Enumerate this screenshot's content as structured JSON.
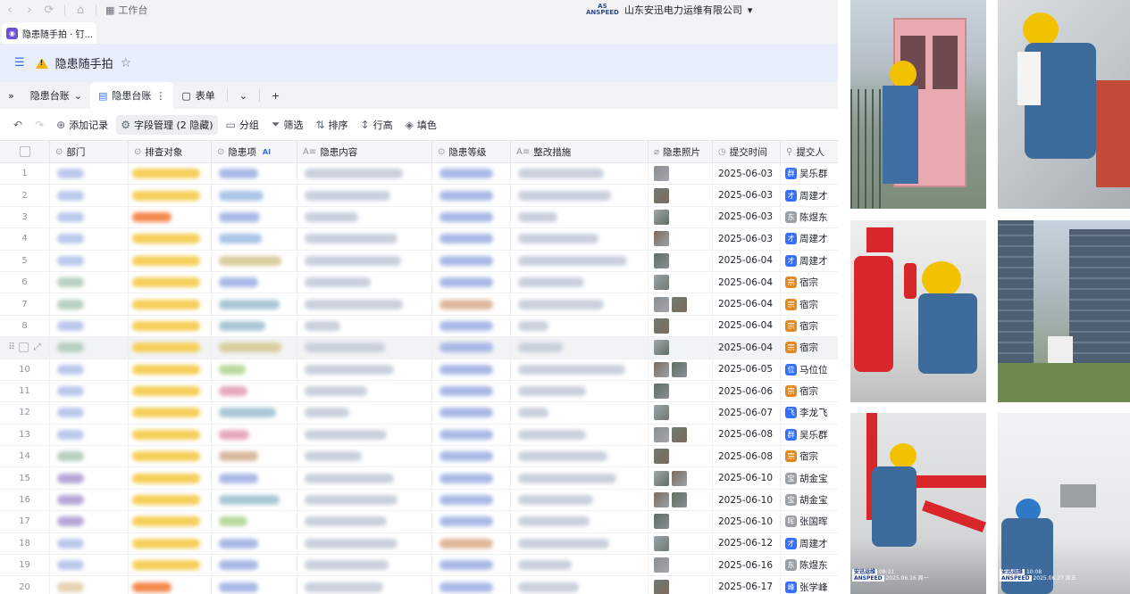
{
  "topbar": {
    "back": "‹",
    "forward": "›",
    "workspace_label": "工作台",
    "org_logo_top": "AS",
    "org_logo_bottom": "ANSPEED",
    "org_name": "山东安迅电力运维有限公司",
    "org_caret": "▾"
  },
  "browser_tab": {
    "icon": "◉",
    "title": "隐患随手拍 · 钉..."
  },
  "header": {
    "title": "隐患随手拍"
  },
  "view_tabs": {
    "collapse": "»",
    "ledger_dropdown": "隐患台账",
    "ledger_tab": "隐患台账",
    "form_tab": "表单",
    "more": "⌄",
    "add": "+"
  },
  "toolbar": {
    "undo": "↶",
    "redo": "↷",
    "add_record": "添加记录",
    "field_manage": "字段管理 (2 隐藏)",
    "group": "分组",
    "filter": "筛选",
    "sort": "排序",
    "row_height": "行高",
    "fill_color": "填色"
  },
  "columns": {
    "dept": "部门",
    "target": "排查对象",
    "item": "隐患项",
    "item_ai": "AI",
    "content": "隐患内容",
    "level": "隐患等级",
    "measure": "整改措施",
    "photos": "隐患照片",
    "time": "提交时间",
    "submitter": "提交人"
  },
  "colors": {
    "accent": "#3370ff",
    "header_bg": "#e8eefc",
    "warning": "#f5b400"
  },
  "rows": [
    {
      "num": "1",
      "date": "2025-06-03",
      "user": "吴乐群",
      "av": "blue",
      "target": "yellow",
      "photos": 1,
      "level": "blue"
    },
    {
      "num": "2",
      "date": "2025-06-03",
      "user": "周建才",
      "av": "blue",
      "target": "yellow",
      "photos": 1,
      "level": "blue"
    },
    {
      "num": "3",
      "date": "2025-06-03",
      "user": "陈煜东",
      "av": "photo",
      "target": "orange",
      "photos": 1,
      "level": "blue"
    },
    {
      "num": "4",
      "date": "2025-06-03",
      "user": "周建才",
      "av": "blue",
      "target": "yellow",
      "photos": 1,
      "level": "blue"
    },
    {
      "num": "5",
      "date": "2025-06-04",
      "user": "周建才",
      "av": "blue",
      "target": "yellow",
      "photos": 1,
      "level": "blue"
    },
    {
      "num": "6",
      "date": "2025-06-04",
      "user": "宿宗",
      "av": "orange",
      "target": "yellow",
      "photos": 1,
      "level": "blue"
    },
    {
      "num": "7",
      "date": "2025-06-04",
      "user": "宿宗",
      "av": "orange",
      "target": "yellow",
      "photos": 2,
      "level": "orange"
    },
    {
      "num": "8",
      "date": "2025-06-04",
      "user": "宿宗",
      "av": "orange",
      "target": "yellow",
      "photos": 1,
      "level": "blue"
    },
    {
      "num": "",
      "date": "2025-06-04",
      "user": "宿宗",
      "av": "orange",
      "target": "yellow",
      "photos": 1,
      "level": "blue"
    },
    {
      "num": "10",
      "date": "2025-06-05",
      "user": "马位位",
      "av": "blue",
      "target": "yellow",
      "photos": 2,
      "level": "blue"
    },
    {
      "num": "11",
      "date": "2025-06-06",
      "user": "宿宗",
      "av": "orange",
      "target": "yellow",
      "photos": 1,
      "level": "blue"
    },
    {
      "num": "12",
      "date": "2025-06-07",
      "user": "李龙飞",
      "av": "blue",
      "target": "yellow",
      "photos": 1,
      "level": "blue"
    },
    {
      "num": "13",
      "date": "2025-06-08",
      "user": "吴乐群",
      "av": "blue",
      "target": "yellow",
      "photos": 2,
      "level": "blue"
    },
    {
      "num": "14",
      "date": "2025-06-08",
      "user": "宿宗",
      "av": "orange",
      "target": "yellow",
      "photos": 1,
      "level": "blue"
    },
    {
      "num": "15",
      "date": "2025-06-10",
      "user": "胡金宝",
      "av": "photo",
      "target": "yellow",
      "photos": 2,
      "level": "blue"
    },
    {
      "num": "16",
      "date": "2025-06-10",
      "user": "胡金宝",
      "av": "photo",
      "target": "yellow",
      "photos": 2,
      "level": "blue"
    },
    {
      "num": "17",
      "date": "2025-06-10",
      "user": "张国晖",
      "av": "photo",
      "target": "yellow",
      "photos": 1,
      "level": "blue"
    },
    {
      "num": "18",
      "date": "2025-06-12",
      "user": "周建才",
      "av": "blue",
      "target": "yellow",
      "photos": 1,
      "level": "orange"
    },
    {
      "num": "19",
      "date": "2025-06-16",
      "user": "陈煜东",
      "av": "photo",
      "target": "yellow",
      "photos": 1,
      "level": "blue"
    },
    {
      "num": "20",
      "date": "2025-06-17",
      "user": "张学峰",
      "av": "blue",
      "target": "orange",
      "photos": 1,
      "level": "blue"
    }
  ],
  "photo_watermarks": [
    {
      "brand_cn": "安迅运维",
      "brand_en": "ANSPEED",
      "time": "08:21",
      "date": "2025.06.16 周一"
    },
    {
      "brand_cn": "安迅运维",
      "brand_en": "ANSPEED",
      "time": "10:08",
      "date": "2025.06.27 周五"
    }
  ]
}
